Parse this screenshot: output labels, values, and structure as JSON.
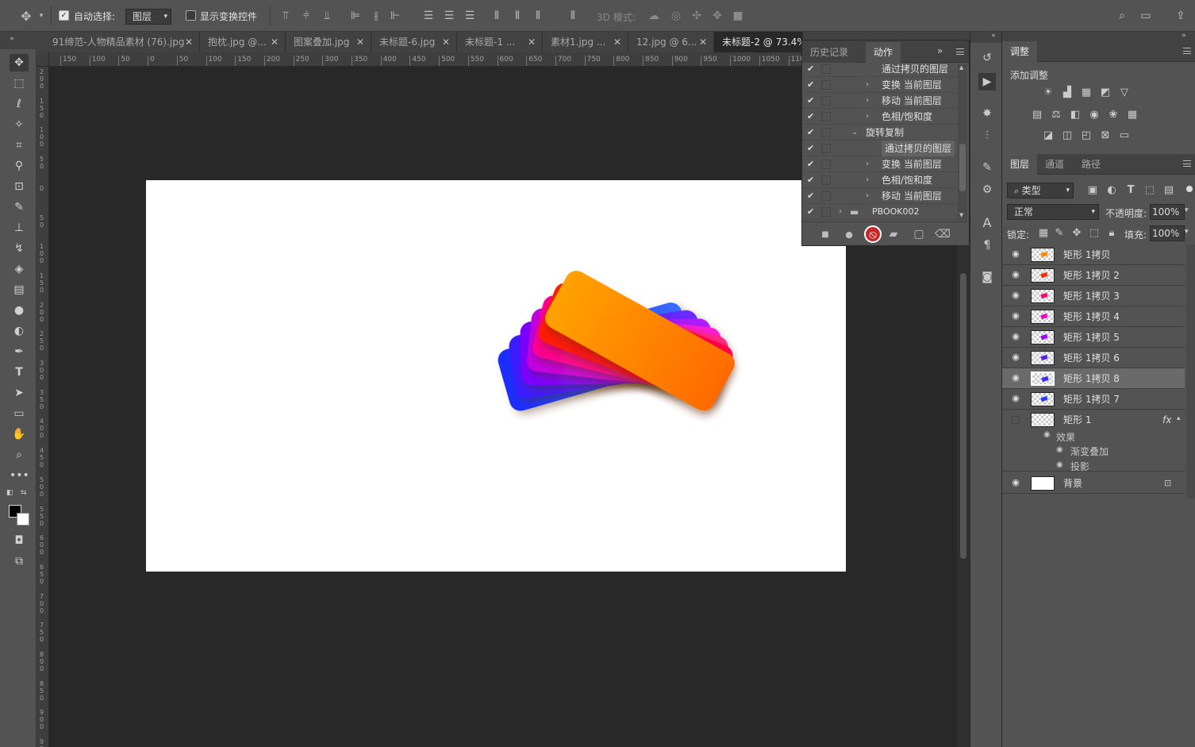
{
  "options_bar": {
    "auto_select_label": "自动选择:",
    "auto_select_checked": true,
    "auto_select_value": "图层",
    "show_transform_label": "显示变换控件",
    "show_transform_checked": false,
    "mode_3d_label": "3D 模式:"
  },
  "tabs": [
    {
      "label": "91缔范-人物精品素材 (76).jpg"
    },
    {
      "label": "抱枕.jpg @..."
    },
    {
      "label": "图案叠加.jpg"
    },
    {
      "label": "未标题-6.jpg"
    },
    {
      "label": "未标题-1 ..."
    },
    {
      "label": "素材1.jpg ..."
    },
    {
      "label": "12.jpg @ 6..."
    },
    {
      "label": "未标题-2 @ 73.4%"
    }
  ],
  "ruler_h": [
    "150",
    "100",
    "50",
    "0",
    "50",
    "100",
    "150",
    "200",
    "250",
    "300",
    "350",
    "400",
    "450",
    "500",
    "550",
    "600",
    "650",
    "700",
    "750",
    "800",
    "850",
    "900",
    "950",
    "1000",
    "1050",
    "110"
  ],
  "ruler_v": [
    "2 0 0",
    "1 5 0",
    "1 0 0",
    "5 0",
    "0",
    "5 0",
    "1 0 0",
    "1 5 0",
    "2 0 0",
    "2 5 0",
    "3 0 0",
    "3 5 0",
    "4 0 0",
    "4 5 0",
    "5 0 0",
    "5 5 0",
    "6 0 0",
    "6 5 0",
    "7 0 0",
    "7 5 0",
    "8 0 0",
    "8 5 0",
    "9 0 0",
    "9 5 0"
  ],
  "actions_panel": {
    "tabs": [
      {
        "label": "历史记录"
      },
      {
        "label": "动作"
      }
    ],
    "rows": [
      {
        "label": "通过拷贝的图层",
        "indent": 3,
        "arrow": "",
        "checked": true,
        "hl": false
      },
      {
        "label": "变换 当前图层",
        "indent": 3,
        "arrow": "›",
        "checked": true,
        "hl": false
      },
      {
        "label": "移动 当前图层",
        "indent": 3,
        "arrow": "›",
        "checked": true,
        "hl": false
      },
      {
        "label": "色相/饱和度",
        "indent": 3,
        "arrow": "›",
        "checked": true,
        "hl": false
      },
      {
        "label": "旋转复制",
        "indent": 2,
        "arrow": "⌄",
        "checked": true,
        "hl": false
      },
      {
        "label": "通过拷贝的图层",
        "indent": 3,
        "arrow": "",
        "checked": true,
        "hl": true
      },
      {
        "label": "变换 当前图层",
        "indent": 3,
        "arrow": "›",
        "checked": true,
        "hl": false
      },
      {
        "label": "色相/饱和度",
        "indent": 3,
        "arrow": "›",
        "checked": true,
        "hl": false
      },
      {
        "label": "移动 当前图层",
        "indent": 3,
        "arrow": "›",
        "checked": true,
        "hl": false
      },
      {
        "label": "PBOOK002",
        "indent": 1,
        "arrow": "›",
        "checked": true,
        "hl": false
      }
    ]
  },
  "adjustments": {
    "tab": "调整",
    "add_label": "添加调整"
  },
  "layers_panel": {
    "tabs": [
      {
        "label": "图层"
      },
      {
        "label": "通道"
      },
      {
        "label": "路径"
      }
    ],
    "filter_label": "类型",
    "blend_mode": "正常",
    "opacity_label": "不透明度:",
    "opacity_value": "100%",
    "lock_label": "锁定:",
    "fill_label": "填充:",
    "fill_value": "100%",
    "layers": [
      {
        "name": "矩形 1拷贝",
        "selected": false,
        "color": "#ff8c00"
      },
      {
        "name": "矩形 1拷贝 2",
        "selected": false,
        "color": "#ff2a00"
      },
      {
        "name": "矩形 1拷贝 3",
        "selected": false,
        "color": "#ff0070"
      },
      {
        "name": "矩形 1拷贝 4",
        "selected": false,
        "color": "#ee00c8"
      },
      {
        "name": "矩形 1拷贝 5",
        "selected": false,
        "color": "#a000ff"
      },
      {
        "name": "矩形 1拷贝 6",
        "selected": false,
        "color": "#5a1cff"
      },
      {
        "name": "矩形 1拷贝 8",
        "selected": true,
        "color": "#3a28ff"
      },
      {
        "name": "矩形 1拷贝 7",
        "selected": false,
        "color": "#2a3aff"
      }
    ],
    "shape_layer": {
      "name": "矩形 1",
      "fx": "fx",
      "effects_label": "效果",
      "effects": [
        {
          "label": "渐变叠加"
        },
        {
          "label": "投影"
        }
      ]
    },
    "background_layer": {
      "name": "背景"
    }
  },
  "artwork": {
    "cards": [
      {
        "c1": "#1a2cff",
        "c2": "#3a6aff"
      },
      {
        "c1": "#3a1cff",
        "c2": "#6a2aff"
      },
      {
        "c1": "#7a00ff",
        "c2": "#b020ff"
      },
      {
        "c1": "#c000e0",
        "c2": "#ff20d0"
      },
      {
        "c1": "#ff0090",
        "c2": "#ff2a80"
      },
      {
        "c1": "#ff2000",
        "c2": "#ff0050"
      },
      {
        "c1": "#ffa200",
        "c2": "#ff6a00"
      }
    ]
  }
}
